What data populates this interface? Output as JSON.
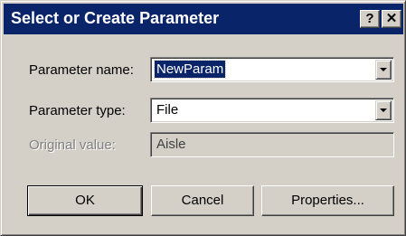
{
  "window": {
    "title": "Select or Create Parameter",
    "help_label": "?",
    "close_label": "✕"
  },
  "fields": {
    "name_label": "Parameter name:",
    "name_value": "NewParam",
    "type_label": "Parameter type:",
    "type_value": "File",
    "original_label": "Original value:",
    "original_value": "Aisle"
  },
  "buttons": {
    "ok": "OK",
    "cancel": "Cancel",
    "properties": "Properties..."
  },
  "colors": {
    "titlebar": "#0a246a",
    "dialog_face": "#d4d0c8",
    "selection": "#0a246a"
  }
}
